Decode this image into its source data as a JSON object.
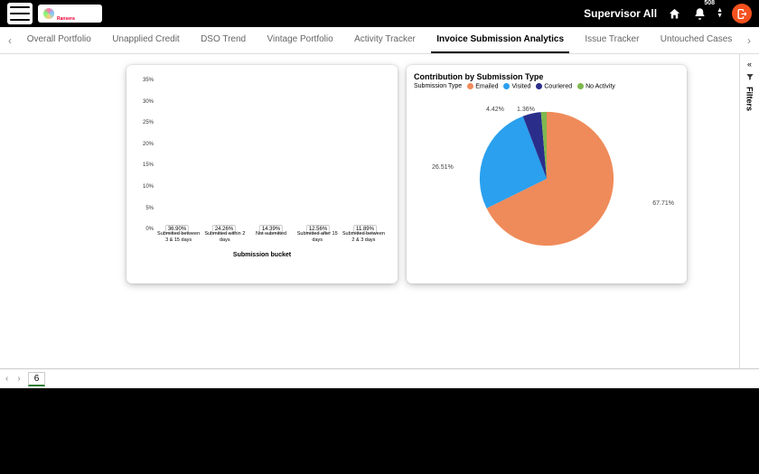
{
  "header": {
    "brand": "IneBura",
    "brand_sub": "Ransera",
    "user_label": "Supervisor All",
    "notification_count": "508"
  },
  "tabs": [
    "Overall Portfolio",
    "Unapplied Credit",
    "DSO Trend",
    "Vintage Portfolio",
    "Activity Tracker",
    "Invoice Submission Analytics",
    "Issue Tracker",
    "Untouched Cases"
  ],
  "active_tab_index": 5,
  "filters_label": "Filters",
  "pie": {
    "title": "Contribution by Submission Type",
    "legend_label": "Submission Type",
    "series_names": [
      "Emailed",
      "Visited",
      "Couriered",
      "No Activity"
    ],
    "colors": [
      "#ef8b5a",
      "#2aa0ee",
      "#2a2e8a",
      "#7fb84f"
    ],
    "labels": {
      "emailed": "67.71%",
      "visited": "26.51%",
      "couriered": "4.42%",
      "noactivity": "1.36%"
    }
  },
  "footer": {
    "page": "6"
  },
  "chart_data": [
    {
      "type": "bar",
      "title": "",
      "xlabel": "Submission bucket",
      "ylabel": "",
      "ylim": [
        0,
        37
      ],
      "y_ticks": [
        "0%",
        "5%",
        "10%",
        "15%",
        "20%",
        "25%",
        "30%",
        "35%"
      ],
      "categories": [
        "Submitted between 3 & 15 days",
        "Submitted within 2 days",
        "Not submitted",
        "Submitted after 15 days",
        "Submitted between 2 & 3 days"
      ],
      "values": [
        36.9,
        24.26,
        14.39,
        12.56,
        11.89
      ],
      "value_labels": [
        "36.90%",
        "24.26%",
        "14.39%",
        "12.56%",
        "11.89%"
      ],
      "bar_color": "#1da1f2"
    },
    {
      "type": "pie",
      "title": "Contribution by Submission Type",
      "series": [
        {
          "name": "Emailed",
          "value": 67.71,
          "color": "#ef8b5a"
        },
        {
          "name": "Visited",
          "value": 26.51,
          "color": "#2aa0ee"
        },
        {
          "name": "Couriered",
          "value": 4.42,
          "color": "#2a2e8a"
        },
        {
          "name": "No Activity",
          "value": 1.36,
          "color": "#7fb84f"
        }
      ]
    }
  ]
}
